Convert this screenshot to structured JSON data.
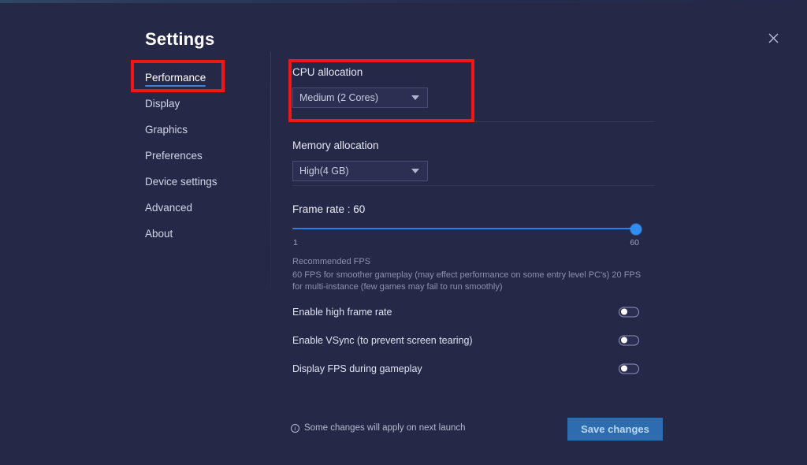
{
  "window": {
    "title": "Settings",
    "close_icon": "close-icon"
  },
  "sidebar": {
    "items": [
      {
        "label": "Performance",
        "active": true
      },
      {
        "label": "Display",
        "active": false
      },
      {
        "label": "Graphics",
        "active": false
      },
      {
        "label": "Preferences",
        "active": false
      },
      {
        "label": "Device settings",
        "active": false
      },
      {
        "label": "Advanced",
        "active": false
      },
      {
        "label": "About",
        "active": false
      }
    ]
  },
  "performance": {
    "cpu": {
      "label": "CPU allocation",
      "value": "Medium (2 Cores)",
      "caret_icon": "chevron-down-icon"
    },
    "memory": {
      "label": "Memory allocation",
      "value": "High(4 GB)",
      "caret_icon": "chevron-down-icon"
    },
    "frame_rate": {
      "label": "Frame rate : 60",
      "value": 60,
      "min_label": "1",
      "max_label": "60",
      "min": 1,
      "max": 60
    },
    "recommended": {
      "title": "Recommended FPS",
      "body": "60 FPS for smoother gameplay (may effect performance on some entry level PC's) 20 FPS for multi-instance (few games may fail to run smoothly)"
    },
    "toggles": [
      {
        "label": "Enable high frame rate",
        "on": false
      },
      {
        "label": "Enable VSync (to prevent screen tearing)",
        "on": false
      },
      {
        "label": "Display FPS during gameplay",
        "on": false
      }
    ]
  },
  "footer": {
    "note": "Some changes will apply on next launch",
    "info_icon": "info-icon",
    "save_label": "Save changes"
  },
  "colors": {
    "background": "#262847",
    "accent_blue": "#2f8ef0",
    "active_underline": "#3f7fd4",
    "save_button": "#2e6cb0",
    "save_text": "#bcd8f5",
    "highlight_red": "#f21616",
    "muted_text": "#8d91ad"
  }
}
